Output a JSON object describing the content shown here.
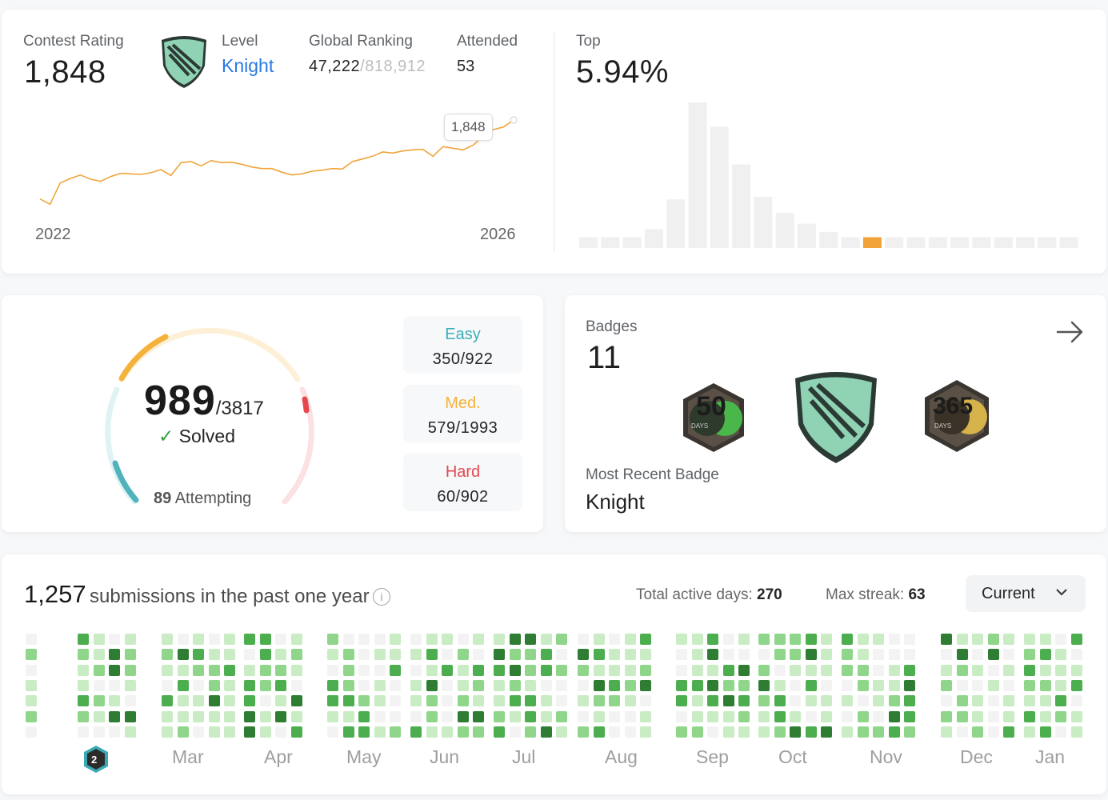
{
  "contest": {
    "rating_label": "Contest Rating",
    "rating": "1,848",
    "level_label": "Level",
    "level": "Knight",
    "ranking_label": "Global Ranking",
    "ranking": "47,222",
    "ranking_total": "/818,912",
    "attended_label": "Attended",
    "attended": "53",
    "start_year": "2022",
    "end_year": "2026",
    "tooltip": "1,848",
    "top_label": "Top",
    "top_value": "5.94%",
    "line_color": "#f0a43a",
    "highlight_color": "#f0a43a",
    "rating_history": [
      1700,
      1690,
      1730,
      1738,
      1745,
      1737,
      1733,
      1742,
      1748,
      1747,
      1746,
      1749,
      1755,
      1744,
      1768,
      1770,
      1762,
      1772,
      1768,
      1769,
      1765,
      1760,
      1757,
      1757,
      1750,
      1745,
      1747,
      1752,
      1754,
      1757,
      1756,
      1770,
      1775,
      1780,
      1788,
      1786,
      1790,
      1792,
      1793,
      1780,
      1798,
      1795,
      1792,
      1801,
      1818,
      1830,
      1835,
      1848
    ]
  },
  "distribution": {
    "values": [
      4,
      4,
      4,
      7,
      18,
      54,
      45,
      31,
      19,
      13,
      9,
      6,
      4,
      4,
      4,
      4,
      4,
      4,
      4,
      4,
      4,
      4,
      4
    ],
    "highlight_index": 13
  },
  "solved": {
    "solved": "989",
    "total": "/3817",
    "solved_label": "Solved",
    "attempting_count": "89",
    "attempting_label": "Attempting",
    "easy_label": "Easy",
    "easy": "350/922",
    "medium_label": "Med.",
    "medium": "579/1993",
    "hard_label": "Hard",
    "hard": "60/902",
    "easy_color": "#3dadb8",
    "medium_color": "#f5b23b",
    "hard_color": "#e5484d"
  },
  "badges": {
    "label": "Badges",
    "count": "11",
    "recent_label": "Most Recent Badge",
    "recent": "Knight",
    "items": [
      {
        "name": "50-days-badge",
        "text": "50",
        "days": "DAYS",
        "color": "#49b74a"
      },
      {
        "name": "knight-badge",
        "text": "",
        "days": "",
        "color": "#8fd3b4"
      },
      {
        "name": "365-days-badge",
        "text": "365",
        "days": "DAYS",
        "color": "#d6b24a"
      }
    ]
  },
  "submissions": {
    "count": "1,257",
    "text": "submissions in the past one year",
    "active_days_label": "Total active days:",
    "active_days": "270",
    "max_streak_label": "Max streak:",
    "max_streak": "63",
    "dropdown": "Current",
    "months": [
      "Mar",
      "Apr",
      "May",
      "Jun",
      "Jul",
      "Aug",
      "Sep",
      "Oct",
      "Nov",
      "Dec",
      "Jan"
    ],
    "first_month_badge": "2",
    "levels_colors": [
      "#f3f3f3",
      "#c9ecc4",
      "#8fd68b",
      "#4cae4f",
      "#2e7d32"
    ]
  }
}
